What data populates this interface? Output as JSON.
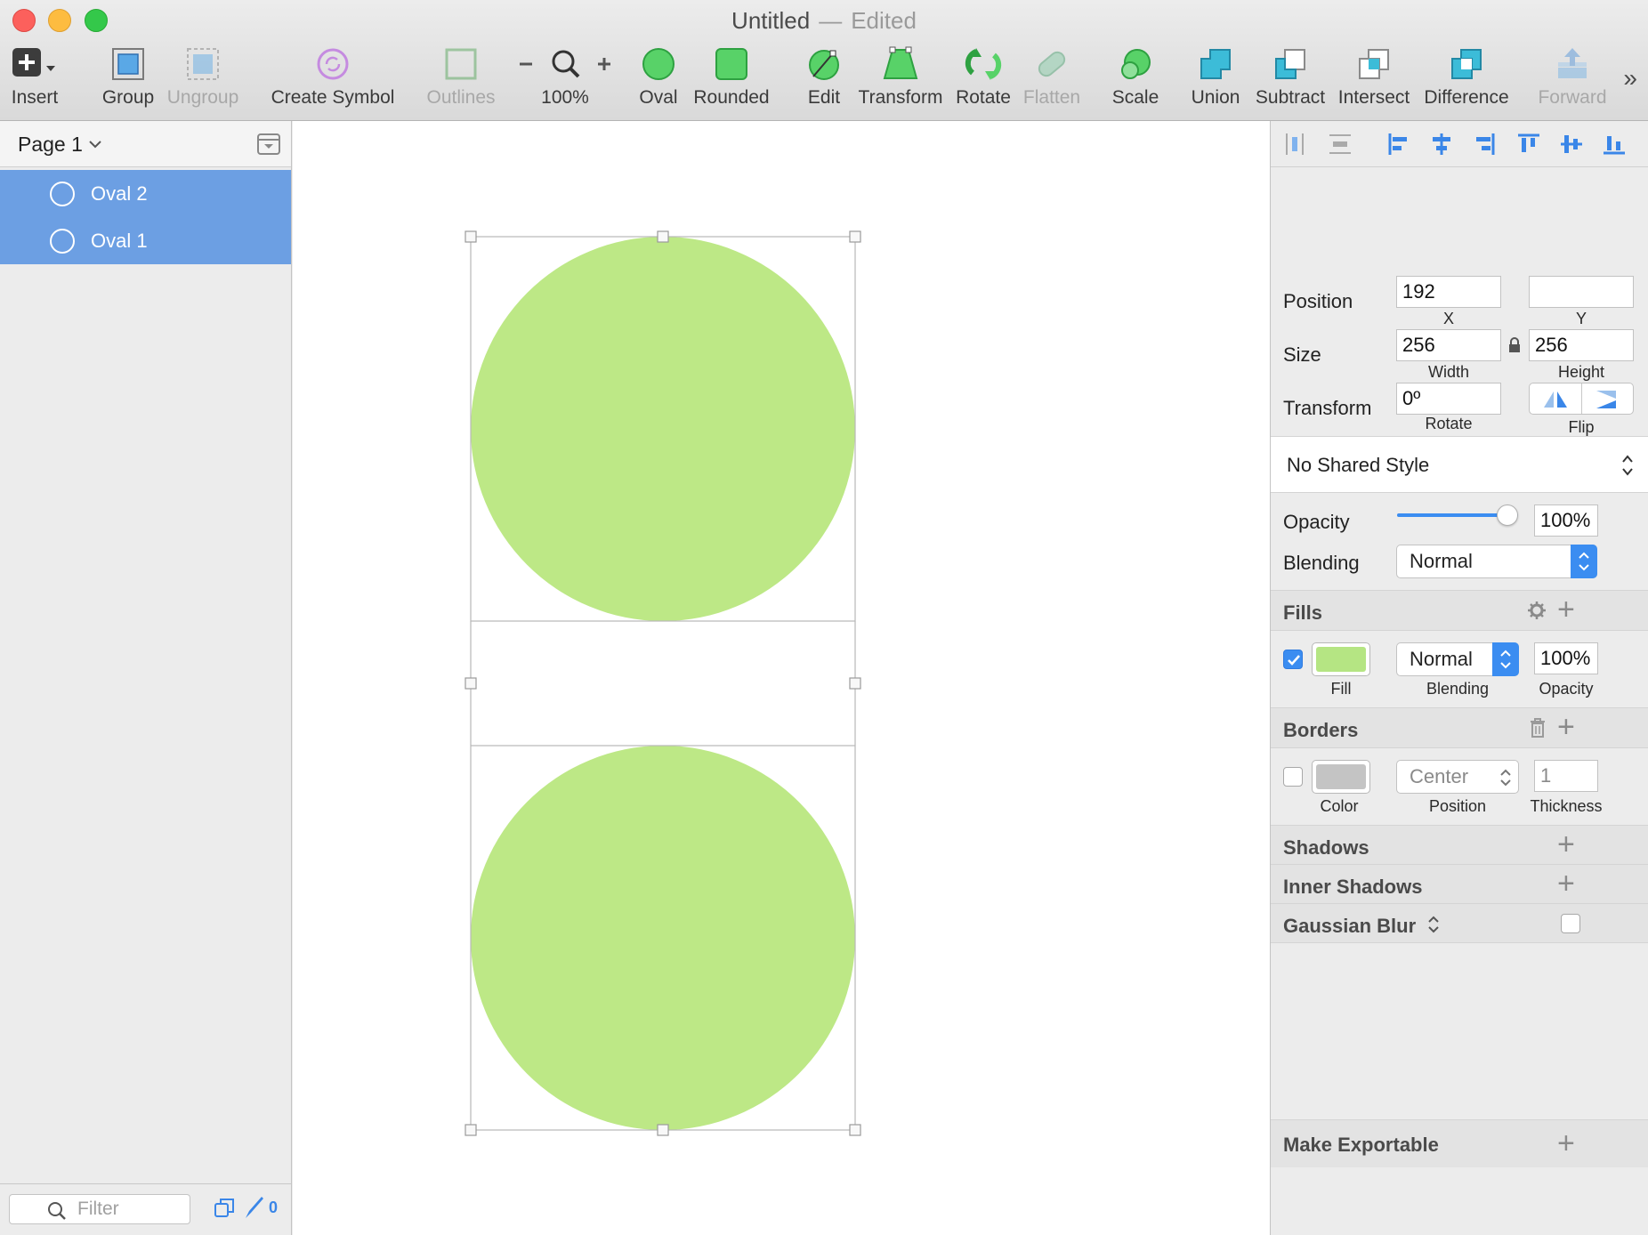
{
  "window": {
    "title": "Untitled",
    "separator": "—",
    "status": "Edited"
  },
  "toolbar": {
    "insert": "Insert",
    "group": "Group",
    "ungroup": "Ungroup",
    "create_symbol": "Create Symbol",
    "outlines": "Outlines",
    "zoom": "100%",
    "oval": "Oval",
    "rounded": "Rounded",
    "edit": "Edit",
    "transform": "Transform",
    "rotate": "Rotate",
    "flatten": "Flatten",
    "scale": "Scale",
    "union": "Union",
    "subtract": "Subtract",
    "intersect": "Intersect",
    "difference": "Difference",
    "forward": "Forward",
    "more": "»"
  },
  "layers": {
    "page": "Page 1",
    "items": [
      {
        "label": "Oval 2"
      },
      {
        "label": "Oval 1"
      }
    ],
    "filter_placeholder": "Filter",
    "slice_count": "0"
  },
  "canvas": {
    "fill_color": "#bde886",
    "selection_color": "#b8b8b8"
  },
  "inspector": {
    "position_label": "Position",
    "x_value": "192",
    "x_label": "X",
    "y_value": "",
    "y_label": "Y",
    "size_label": "Size",
    "width_value": "256",
    "width_label": "Width",
    "height_value": "256",
    "height_label": "Height",
    "transform_label": "Transform",
    "rotate_value": "0º",
    "rotate_label": "Rotate",
    "flip_label": "Flip",
    "shared_style": "No Shared Style",
    "opacity_label": "Opacity",
    "opacity_value": "100%",
    "opacity_level": 1.0,
    "blending_label": "Blending",
    "blending_value": "Normal",
    "fills": {
      "title": "Fills",
      "enabled": true,
      "color": "#b5e583",
      "blending": "Normal",
      "opacity": "100%",
      "fill_label": "Fill",
      "blending_label": "Blending",
      "opacity_label": "Opacity"
    },
    "borders": {
      "title": "Borders",
      "enabled": false,
      "color": "#c4c4c4",
      "position": "Center",
      "thickness": "1",
      "color_label": "Color",
      "position_label": "Position",
      "thickness_label": "Thickness"
    },
    "shadows_title": "Shadows",
    "inner_shadows_title": "Inner Shadows",
    "gaussian_blur_title": "Gaussian Blur",
    "make_exportable": "Make Exportable"
  },
  "colors": {
    "accent": "#3b8df1",
    "selection_row": "#6c9fe3"
  }
}
